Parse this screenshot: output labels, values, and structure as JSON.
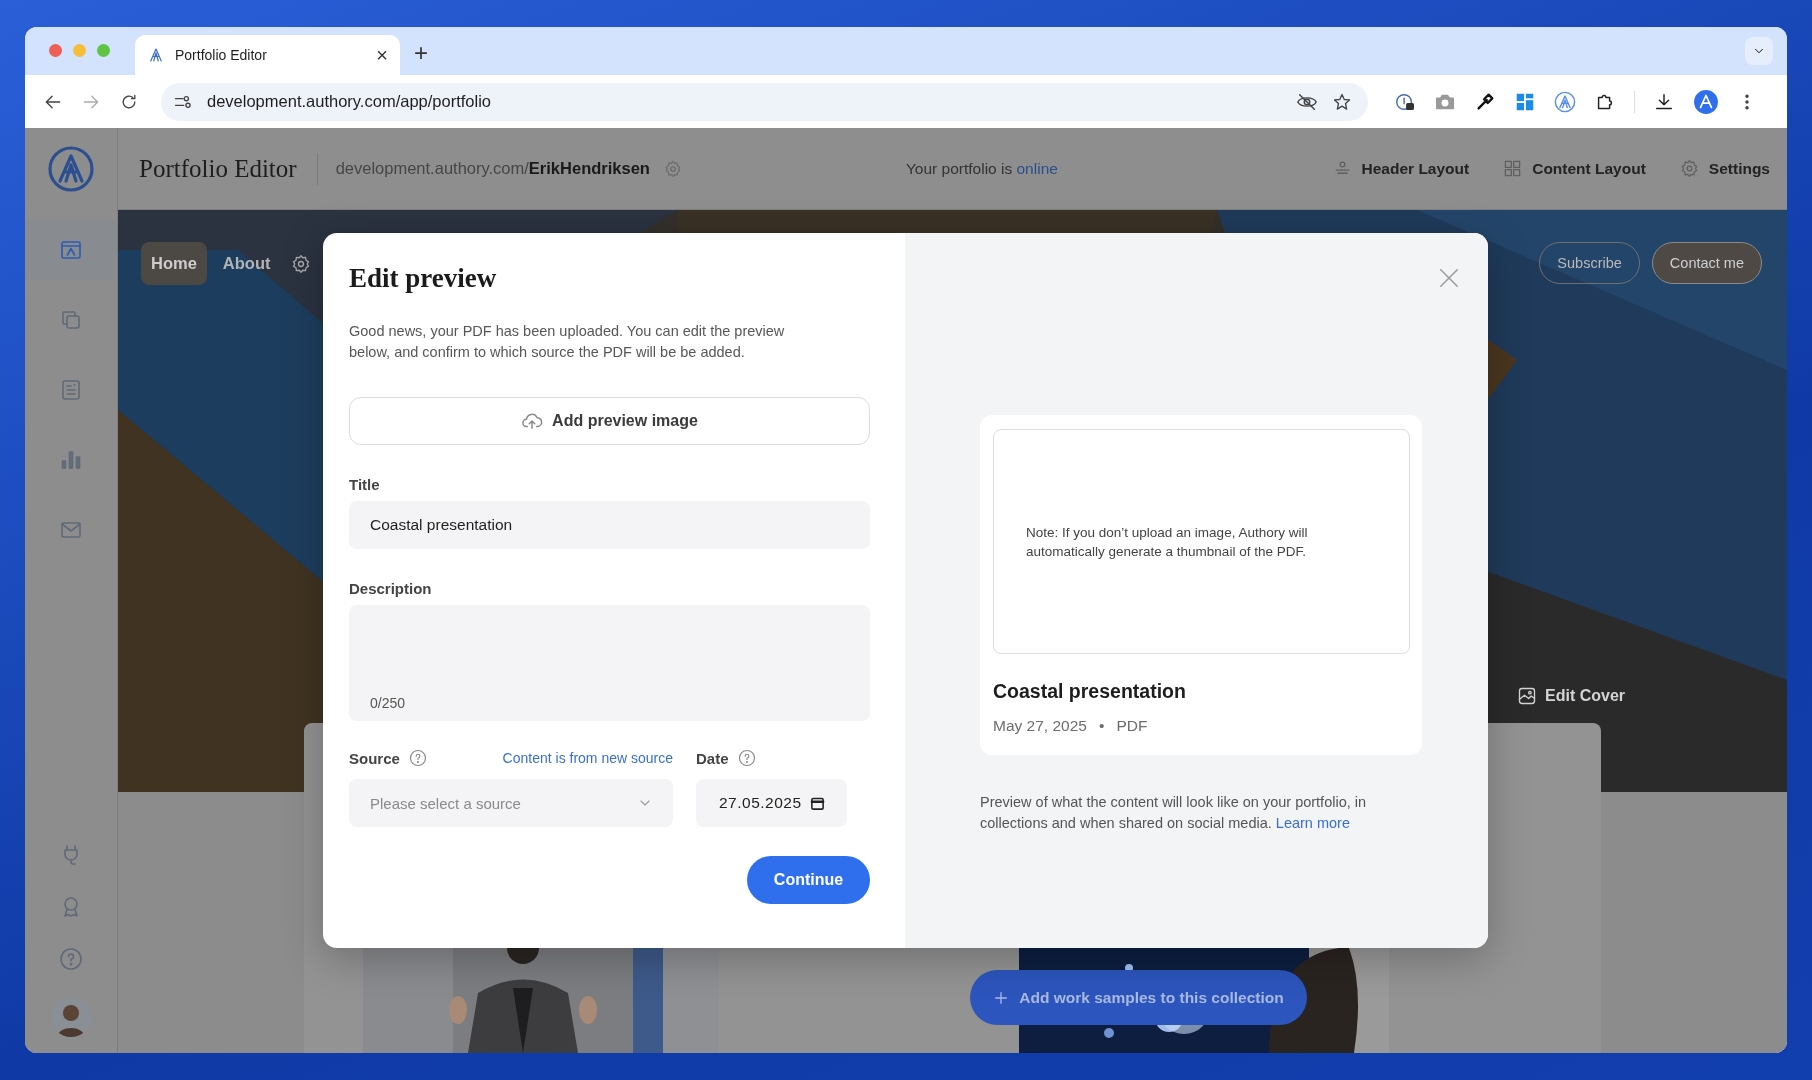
{
  "browser": {
    "tabs": [
      {
        "title": "Portfolio Editor",
        "selected": true,
        "close": "×"
      }
    ],
    "new_tab": "+",
    "url": "development.authory.com/app/portfolio"
  },
  "header": {
    "title": "Portfolio Editor",
    "url_prefix": "development.authory.com/",
    "url_name": "ErikHendriksen",
    "status": "Your portfolio is",
    "status_link": "online",
    "actions": [
      "Header Layout",
      "Content Layout",
      "Settings"
    ]
  },
  "sidebar": {
    "items": [
      {
        "selected": true
      },
      {
        "selected": false
      },
      {
        "selected": false
      },
      {
        "selected": false
      },
      {
        "selected": false
      }
    ],
    "bottom_items": [
      {
        "selected": false
      },
      {
        "selected": false
      },
      {
        "selected": false
      }
    ]
  },
  "cover": {
    "nav": [
      {
        "label": "Home",
        "selected": true
      },
      {
        "label": "About",
        "selected": false
      }
    ],
    "buttons": [
      "Subscribe",
      "Contact me"
    ],
    "edit_cover": "Edit Cover"
  },
  "collection": {
    "add_button": "Add work samples to this collection"
  },
  "modal": {
    "title": "Edit preview",
    "intro": "Good news, your PDF has been uploaded. You can edit the preview below, and confirm to which source the PDF will be be added.",
    "upload_button": "Add preview image",
    "title_label": "Title",
    "title_value": "Coastal presentation",
    "description_label": "Description",
    "description_counter": "0/250",
    "source_label": "Source",
    "source_link": "Content is from new source",
    "source_placeholder": "Please select a source",
    "date_label": "Date",
    "date_value": "27.05.2025",
    "continue_button": "Continue",
    "preview": {
      "note": "Note: If you don’t upload an image, Authory will automatically generate a thumbnail of the PDF.",
      "card_title": "Coastal presentation",
      "date": "May 27, 2025",
      "separator": "•",
      "type": "PDF",
      "footer": "Preview of what the content will look like on your portfolio, in collections and when shared on social media.",
      "footer_link": "Learn more"
    }
  }
}
